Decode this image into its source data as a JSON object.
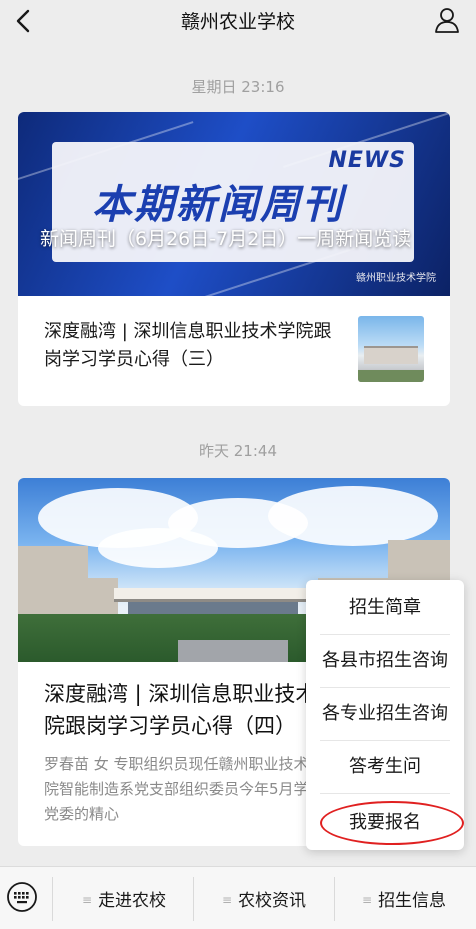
{
  "header": {
    "title": "赣州农业学校",
    "back_icon": "chevron-left-icon",
    "profile_icon": "person-icon"
  },
  "feed": [
    {
      "time": "星期日 23:16",
      "main": {
        "cover_news_label": "NEWS",
        "cover_big_title": "本期新闻周刊",
        "overlay_title": "新闻周刊（6月26日-7月2日）一周新闻览读",
        "watermark": "赣州职业技术学院"
      },
      "sub": {
        "title": "深度融湾 | 深圳信息职业技术学院跟岗学习学员心得（三）"
      }
    },
    {
      "time": "昨天 21:44",
      "main": {
        "title": "深度融湾 | 深圳信息职业技术学院跟岗学习学员心得（四）",
        "desc": "罗春苗 女 专职组织员现任赣州职业技术学院智能制造系党支部组织委员今年5月学院党委的精心"
      }
    }
  ],
  "popup_menu": {
    "items": [
      "招生简章",
      "各县市招生咨询",
      "各专业招生咨询",
      "答考生问",
      "我要报名"
    ],
    "highlight_color": "#e02020"
  },
  "bottom_menu": {
    "keyboard_icon": "keyboard-icon",
    "tabs": [
      {
        "label": "走进农校"
      },
      {
        "label": "农校资讯"
      },
      {
        "label": "招生信息"
      }
    ]
  }
}
